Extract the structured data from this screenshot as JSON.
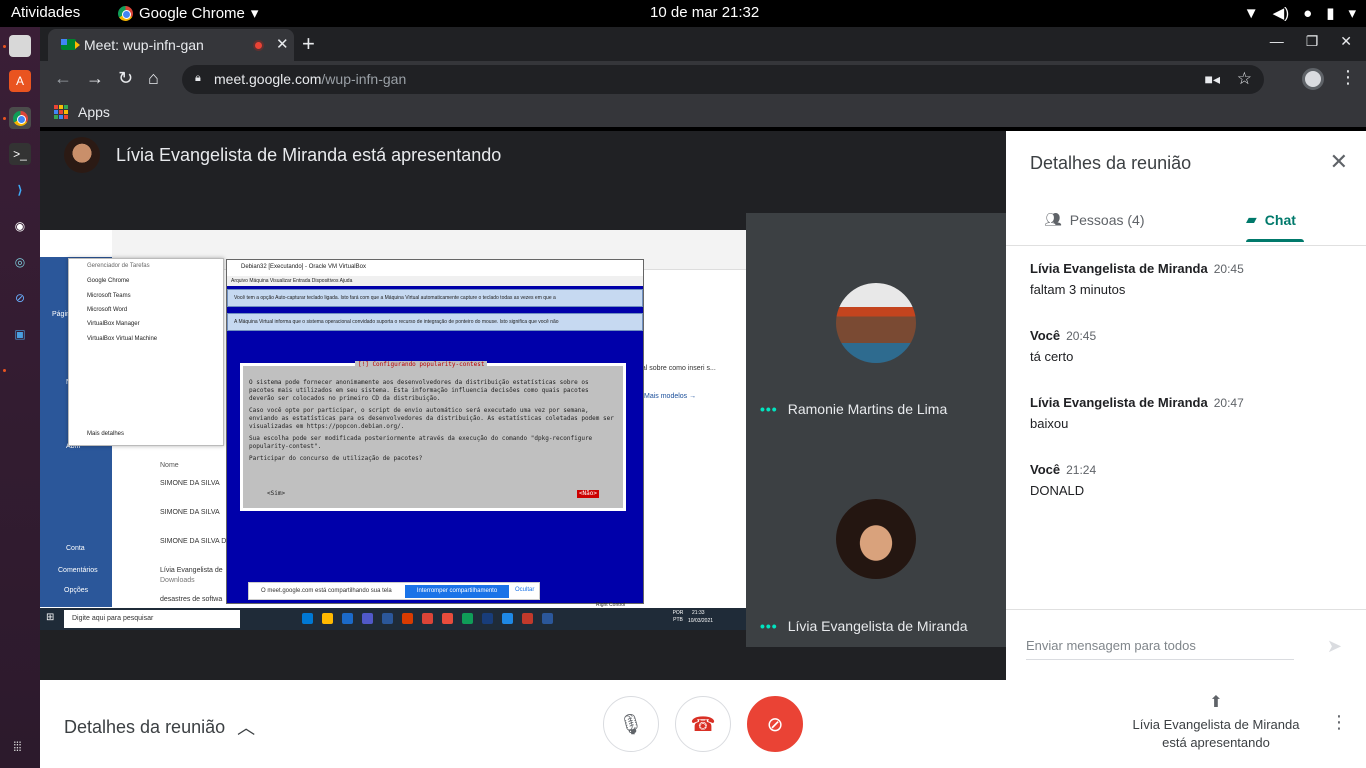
{
  "system": {
    "activities": "Atividades",
    "app_name": "Google Chrome",
    "clock": "10 de mar  21:32"
  },
  "browser": {
    "tab_title": "Meet: wup-infn-gan",
    "url_host": "meet.google.com",
    "url_path": "/wup-infn-gan",
    "bookmark_apps": "Apps"
  },
  "meet": {
    "presenting_banner": "Lívia Evangelista de Miranda está apresentando",
    "participants": [
      {
        "name": "Ramonie Martins de Lima"
      },
      {
        "name": "Lívia Evangelista de Miranda"
      }
    ],
    "shared_screen": {
      "sidebar_labels": [
        "Págin",
        "N",
        "Abrir",
        "Conta",
        "Comentários",
        "Opções"
      ],
      "task_manager_title": "Gerenciador de Tarefas",
      "task_manager_items": [
        "Google Chrome",
        "Microsoft Teams",
        "Microsoft Word",
        "VirtualBox Manager",
        "VirtualBox Virtual Machine"
      ],
      "task_manager_more": "Mais detalhes",
      "vbox_title": "Debian32 [Executando] - Oracle VM VirtualBox",
      "vbox_menu": "Arquivo    Máquina    Visualizar    Entrada    Dispositivos    Ajuda",
      "vbox_note1": "Você tem a opção Auto-capturar teclado ligada. Isto fará com que a Máquina Virtual automaticamente capture o teclado todas as vezes em que a",
      "vbox_note2": "A Máquina Virtual informa que o sistema operacional convidado suporta o recurso de integração de ponteiro do mouse. Isto significa que você não",
      "dialog_title": "[!] Configurando popularity-contest",
      "dialog_text1": "O sistema pode fornecer anonimamente aos desenvolvedores da distribuição estatísticas sobre os pacotes mais utilizados em seu sistema. Esta informação influencia decisões como quais pacotes deverão ser colocados no primeiro CD da distribuição.",
      "dialog_text2": "Caso você opte por participar, o script de envio automático será executado uma vez por semana, enviando as estatísticas para os desenvolvedores da distribuição. As estatísticas coletadas podem ser visualizadas em https://popcon.debian.org/.",
      "dialog_text3": "Sua escolha pode ser modificada posteriormente através da execução do comando \"dpkg-reconfigure popularity-contest\".",
      "dialog_question": "Participar do concurso de utilização de pacotes?",
      "dialog_yes": "<Sim>",
      "dialog_no": "<Não>",
      "doc_header": "Nome",
      "docs": [
        "SIMONE DA SILVA",
        "SIMONE DA SILVA",
        "SIMONE DA SILVA D",
        "Lívia Evangelista de",
        "desastres de softwa"
      ],
      "doc_sub": "Downloads",
      "more_models": "Mais modelos →",
      "tutorial": "rial sobre como inseri s...",
      "share_bar_text": "O meet.google.com está compartilhando sua tela",
      "share_bar_stop": "Interromper compartilhamento",
      "share_bar_hide": "Ocultar",
      "win_search": "Digite aqui para pesquisar",
      "win_clock": "21:33",
      "win_date": "10/03/2021",
      "win_lang": "POR PTB",
      "right_control": "Right Control"
    }
  },
  "panel": {
    "title": "Detalhes da reunião",
    "tab_people": "Pessoas (4)",
    "tab_chat": "Chat",
    "messages": [
      {
        "sender": "Lívia Evangelista de Miranda",
        "time": "20:45",
        "body": "faltam 3 minutos"
      },
      {
        "sender": "Você",
        "time": "20:45",
        "body": "tá certo"
      },
      {
        "sender": "Lívia Evangelista de Miranda",
        "time": "20:47",
        "body": "baixou"
      },
      {
        "sender": "Você",
        "time": "21:24",
        "body": "DONALD"
      }
    ],
    "composer_placeholder": "Enviar mensagem para todos"
  },
  "bottom": {
    "details_label": "Detalhes da reunião",
    "presenting_line1": "Lívia Evangelista de Miranda",
    "presenting_line2": "está apresentando"
  },
  "colors": {
    "accent_teal": "#00796b",
    "hangup_red": "#ea4335",
    "speaking_dots": "#00e5c0"
  }
}
